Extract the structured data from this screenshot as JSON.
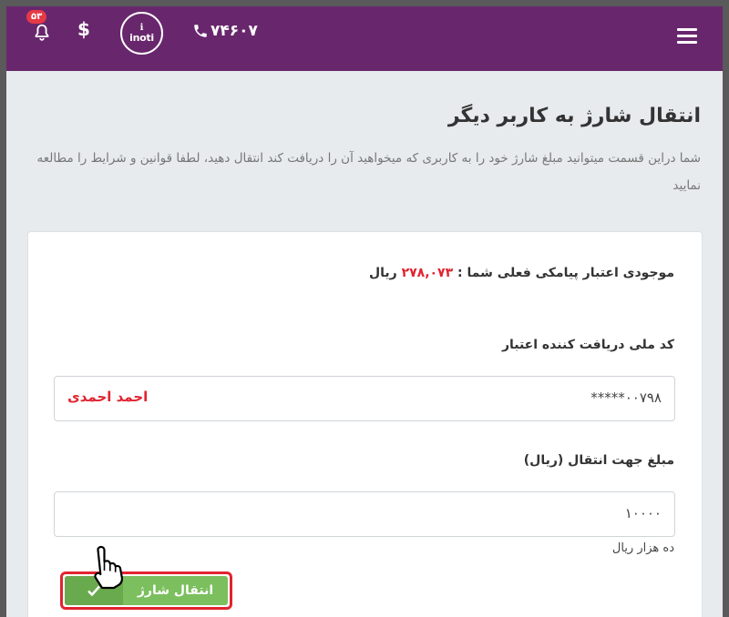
{
  "header": {
    "phone": "۷۴۶۰۷",
    "logo_mark": "ℹ",
    "logo_word": "inoti",
    "currency_symbol": "$",
    "notification_count": "۵۳"
  },
  "page": {
    "title": "انتقال شارژ به کاربر دیگر",
    "description": "شما دراین قسمت میتوانید مبلغ شارژ خود را به کاربری که میخواهید آن را دریافت کند انتقال دهید، لطفا قوانین و شرایط را مطالعه نمایید"
  },
  "form": {
    "balance_label": "موجودی اعتبار پیامکی فعلی شما :",
    "balance_amount": "۲۷۸,۰۷۳",
    "balance_unit": "ریال",
    "national_code_label": "کد ملی دریافت کننده اعتبار",
    "national_code_value": "*****۰۰۷۹۸",
    "recipient_name": "احمد احمدی",
    "amount_label": "مبلغ جهت انتقال (ریال)",
    "amount_value": "۱۰۰۰۰",
    "amount_hint": "ده هزار ریال",
    "submit_label": "انتقال شارژ"
  },
  "colors": {
    "header_bg": "#68276c",
    "accent_red": "#e0242f",
    "button_green": "#7bbf5e"
  }
}
